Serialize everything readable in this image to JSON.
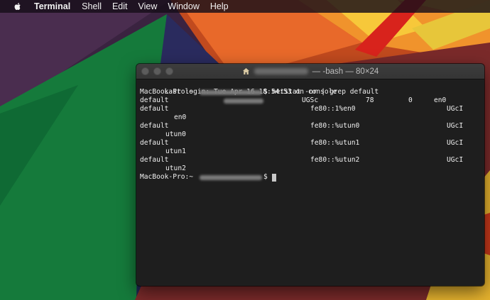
{
  "menubar": {
    "apple_icon": "apple-logo-icon",
    "app_name": "Terminal",
    "items": [
      "Shell",
      "Edit",
      "View",
      "Window",
      "Help"
    ]
  },
  "window": {
    "title_suffix": "— -bash — 80×24",
    "title_icon": "home-folder-icon"
  },
  "terminal": {
    "last_login": "Last login: Tue Apr 16 18:54:53 on console",
    "prompt": "MacBook-Pro:~",
    "prompt_end": "$",
    "command": "netstat -nr | grep default",
    "routes": [
      {
        "destination": "default",
        "gateway": "",
        "flags": "UGSc",
        "refs": "78",
        "use": "0",
        "netif": "en0",
        "wrap": ""
      },
      {
        "destination": "default",
        "gateway": "fe80::1%en0",
        "flags": "UGcI",
        "refs": "",
        "use": "",
        "netif": "",
        "wrap": "en0"
      },
      {
        "destination": "default",
        "gateway": "fe80::%utun0",
        "flags": "UGcI",
        "refs": "",
        "use": "",
        "netif": "",
        "wrap": "utun0"
      },
      {
        "destination": "default",
        "gateway": "fe80::%utun1",
        "flags": "UGcI",
        "refs": "",
        "use": "",
        "netif": "",
        "wrap": "utun1"
      },
      {
        "destination": "default",
        "gateway": "fe80::%utun2",
        "flags": "UGcI",
        "refs": "",
        "use": "",
        "netif": "",
        "wrap": "utun2"
      }
    ]
  },
  "colors": {
    "terminal_bg": "#1e1e1e",
    "text": "#f0f0f0",
    "titlebar": "#3a3a3a"
  }
}
